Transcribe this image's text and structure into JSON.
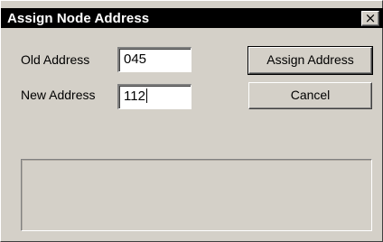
{
  "window": {
    "title": "Assign Node Address",
    "close_glyph": "×"
  },
  "form": {
    "old_address_label": "Old Address",
    "old_address_value": "045",
    "new_address_label": "New Address",
    "new_address_value": "112"
  },
  "buttons": {
    "assign_label": "Assign Address",
    "cancel_label": "Cancel"
  },
  "status": {
    "text": ""
  },
  "icons": {
    "close": "close-icon"
  }
}
